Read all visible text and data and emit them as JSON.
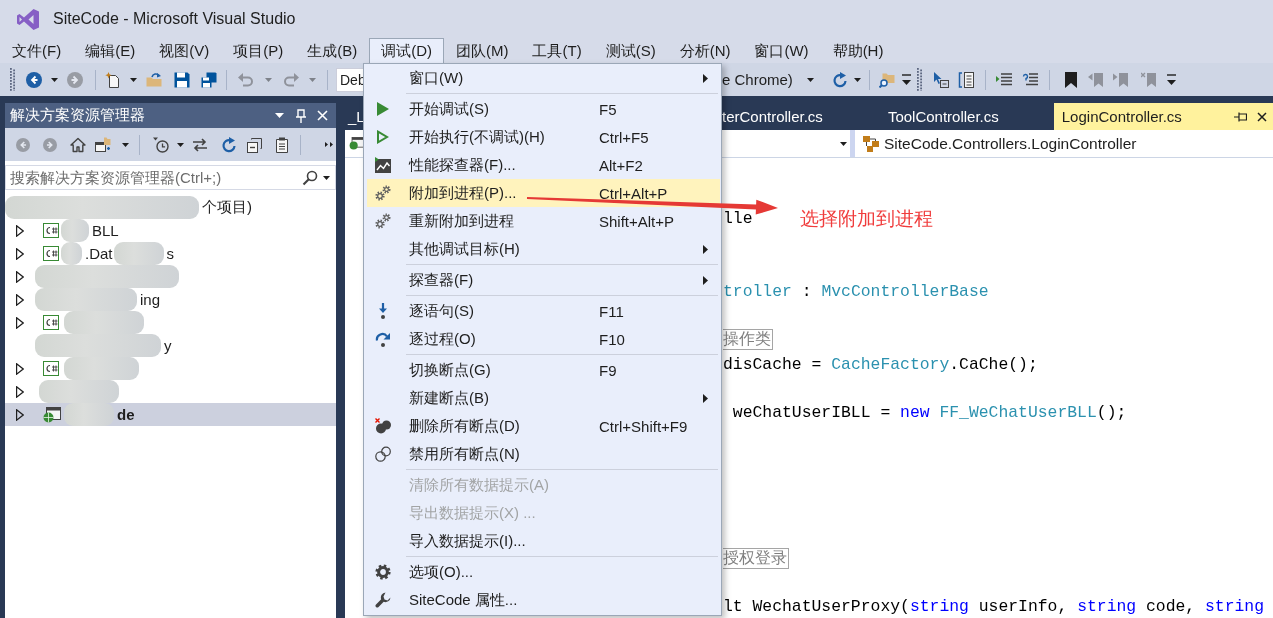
{
  "window": {
    "title": "SiteCode - Microsoft Visual Studio"
  },
  "menu_bar": [
    {
      "label": "文件(F)",
      "selected": false
    },
    {
      "label": "编辑(E)",
      "selected": false
    },
    {
      "label": "视图(V)",
      "selected": false
    },
    {
      "label": "项目(P)",
      "selected": false
    },
    {
      "label": "生成(B)",
      "selected": false
    },
    {
      "label": "调试(D)",
      "selected": true
    },
    {
      "label": "团队(M)",
      "selected": false
    },
    {
      "label": "工具(T)",
      "selected": false
    },
    {
      "label": "测试(S)",
      "selected": false
    },
    {
      "label": "分析(N)",
      "selected": false
    },
    {
      "label": "窗口(W)",
      "selected": false
    },
    {
      "label": "帮助(H)",
      "selected": false
    }
  ],
  "toolbar": {
    "left_buttons": [
      {
        "disabled": false
      },
      {
        "disabled": true
      },
      {
        "disabled": false
      },
      {
        "disabled": false
      },
      {
        "disabled": false
      },
      {
        "disabled": false
      },
      {
        "disabled": true
      },
      {
        "disabled": true
      }
    ],
    "configuration": "Deb",
    "target": "e Chrome)",
    "right_buttons": [
      {
        "disabled": false
      },
      {
        "disabled": false
      },
      {
        "disabled": false
      },
      {
        "disabled": false
      },
      {
        "disabled": false
      },
      {
        "disabled": false
      },
      {
        "disabled": false
      },
      {
        "disabled": true
      },
      {
        "disabled": true
      },
      {
        "disabled": true
      }
    ]
  },
  "solution_explorer": {
    "title": "解决方案资源管理器",
    "toolbar": [
      {
        "disabled": true
      },
      {
        "disabled": true
      },
      {
        "disabled": false
      },
      {
        "disabled": false
      },
      {
        "disabled": false
      },
      {
        "disabled": false
      },
      {
        "disabled": false
      },
      {
        "disabled": false
      },
      {
        "disabled": false
      }
    ],
    "search": {
      "placeholder": "搜索解决方案资源管理器(Ctrl+;)"
    },
    "tree": [
      {
        "kind": "solution",
        "fragments": [
          "个项目)"
        ],
        "selected": false,
        "startup": false
      },
      {
        "kind": "project",
        "fragments": [
          "BLL"
        ],
        "expanded": false,
        "selected": false,
        "startup": false
      },
      {
        "kind": "project",
        "fragments": [
          ".Dat",
          "s"
        ],
        "expanded": false,
        "selected": false,
        "startup": false
      },
      {
        "kind": "masked",
        "expanded": false,
        "selected": false
      },
      {
        "kind": "masked",
        "fragments": [
          "ing"
        ],
        "expanded": false,
        "selected": false,
        "startup": false
      },
      {
        "kind": "project",
        "expanded": false,
        "selected": false
      },
      {
        "kind": "masked",
        "fragments": [
          "y"
        ],
        "selected": false,
        "startup": false
      },
      {
        "kind": "project",
        "expanded": false,
        "selected": false
      },
      {
        "kind": "masked",
        "expanded": false,
        "selected": false
      },
      {
        "kind": "web",
        "fragments": [
          "de"
        ],
        "expanded": false,
        "selected": true,
        "startup": true
      }
    ]
  },
  "editor": {
    "tabs": [
      {
        "label": "_L",
        "selected": false
      },
      {
        "label": "terController.cs",
        "selected": false
      },
      {
        "label": "ToolController.cs",
        "selected": false
      },
      {
        "label": "LoginController.cs",
        "selected": true
      }
    ],
    "navigation": {
      "type_path": "SiteCode.Controllers.LoginController"
    },
    "lines": [
      {
        "kind": "blank"
      },
      {
        "kind": "blank"
      },
      {
        "kind": "code",
        "tokens": [
          {
            "kind": "plain",
            "text": "lle"
          }
        ]
      },
      {
        "kind": "blank"
      },
      {
        "kind": "blank"
      },
      {
        "kind": "code",
        "tokens": [
          {
            "kind": "type",
            "text": "troller"
          },
          {
            "kind": "plain",
            "text": " : "
          },
          {
            "kind": "type",
            "text": "MvcControllerBase"
          }
        ]
      },
      {
        "kind": "blank"
      },
      {
        "kind": "code",
        "tokens": [
          {
            "kind": "collapsed",
            "text": "操作类"
          }
        ]
      },
      {
        "kind": "code",
        "tokens": [
          {
            "kind": "plain",
            "text": "disCache = "
          },
          {
            "kind": "type",
            "text": "CacheFactory"
          },
          {
            "kind": "plain",
            "text": ".CaChe();"
          }
        ]
      },
      {
        "kind": "blank"
      },
      {
        "kind": "code",
        "tokens": [
          {
            "kind": "plain",
            "text": " weChatUserIBLL = "
          },
          {
            "kind": "keyword",
            "text": "new"
          },
          {
            "kind": "type",
            "text": " FF_WeChatUserBLL"
          },
          {
            "kind": "plain",
            "text": "();"
          }
        ]
      },
      {
        "kind": "blank"
      },
      {
        "kind": "blank"
      },
      {
        "kind": "blank"
      },
      {
        "kind": "blank"
      },
      {
        "kind": "blank"
      },
      {
        "kind": "code",
        "tokens": [
          {
            "kind": "collapsed",
            "text": "授权登录"
          }
        ]
      },
      {
        "kind": "blank"
      },
      {
        "kind": "code",
        "tokens": [
          {
            "kind": "plain",
            "text": "lt WechatUserProxy("
          },
          {
            "kind": "keyword",
            "text": "string"
          },
          {
            "kind": "plain",
            "text": " userInfo, "
          },
          {
            "kind": "keyword",
            "text": "string"
          },
          {
            "kind": "plain",
            "text": " code, "
          },
          {
            "kind": "keyword",
            "text": "string"
          }
        ]
      }
    ]
  },
  "debug_menu": {
    "items": [
      {
        "kind": "item",
        "label": "窗口(W)",
        "submenu": true,
        "disabled": false,
        "selected": false
      },
      {
        "kind": "separator"
      },
      {
        "kind": "item",
        "label": "开始调试(S)",
        "shortcut": "F5",
        "submenu": false,
        "disabled": false,
        "selected": false
      },
      {
        "kind": "item",
        "label": "开始执行(不调试)(H)",
        "shortcut": "Ctrl+F5",
        "submenu": false,
        "disabled": false,
        "selected": false
      },
      {
        "kind": "item",
        "label": "性能探查器(F)...",
        "shortcut": "Alt+F2",
        "submenu": false,
        "disabled": false,
        "selected": false
      },
      {
        "kind": "item",
        "label": "附加到进程(P)...",
        "shortcut": "Ctrl+Alt+P",
        "submenu": false,
        "disabled": false,
        "selected": true
      },
      {
        "kind": "item",
        "label": "重新附加到进程",
        "shortcut": "Shift+Alt+P",
        "submenu": false,
        "disabled": false,
        "selected": false
      },
      {
        "kind": "item",
        "label": "其他调试目标(H)",
        "submenu": true,
        "disabled": false,
        "selected": false
      },
      {
        "kind": "separator"
      },
      {
        "kind": "item",
        "label": "探查器(F)",
        "submenu": true,
        "disabled": false,
        "selected": false
      },
      {
        "kind": "separator"
      },
      {
        "kind": "item",
        "label": "逐语句(S)",
        "shortcut": "F11",
        "submenu": false,
        "disabled": false,
        "selected": false
      },
      {
        "kind": "item",
        "label": "逐过程(O)",
        "shortcut": "F10",
        "submenu": false,
        "disabled": false,
        "selected": false
      },
      {
        "kind": "separator"
      },
      {
        "kind": "item",
        "label": "切换断点(G)",
        "shortcut": "F9",
        "submenu": false,
        "disabled": false,
        "selected": false
      },
      {
        "kind": "item",
        "label": "新建断点(B)",
        "submenu": true,
        "disabled": false,
        "selected": false
      },
      {
        "kind": "item",
        "label": "删除所有断点(D)",
        "shortcut": "Ctrl+Shift+F9",
        "submenu": false,
        "disabled": false,
        "selected": false
      },
      {
        "kind": "item",
        "label": "禁用所有断点(N)",
        "submenu": false,
        "disabled": false,
        "selected": false
      },
      {
        "kind": "separator"
      },
      {
        "kind": "item",
        "label": "清除所有数据提示(A)",
        "submenu": false,
        "disabled": true,
        "selected": false
      },
      {
        "kind": "item",
        "label": "导出数据提示(X) ...",
        "submenu": false,
        "disabled": true,
        "selected": false
      },
      {
        "kind": "item",
        "label": "导入数据提示(I)...",
        "submenu": false,
        "disabled": false,
        "selected": false
      },
      {
        "kind": "separator"
      },
      {
        "kind": "item",
        "label": "选项(O)...",
        "submenu": false,
        "disabled": false,
        "selected": false
      },
      {
        "kind": "item",
        "label": "SiteCode 属性...",
        "submenu": false,
        "disabled": false,
        "selected": false
      }
    ]
  },
  "annotation": {
    "text": "选择附加到进程"
  }
}
